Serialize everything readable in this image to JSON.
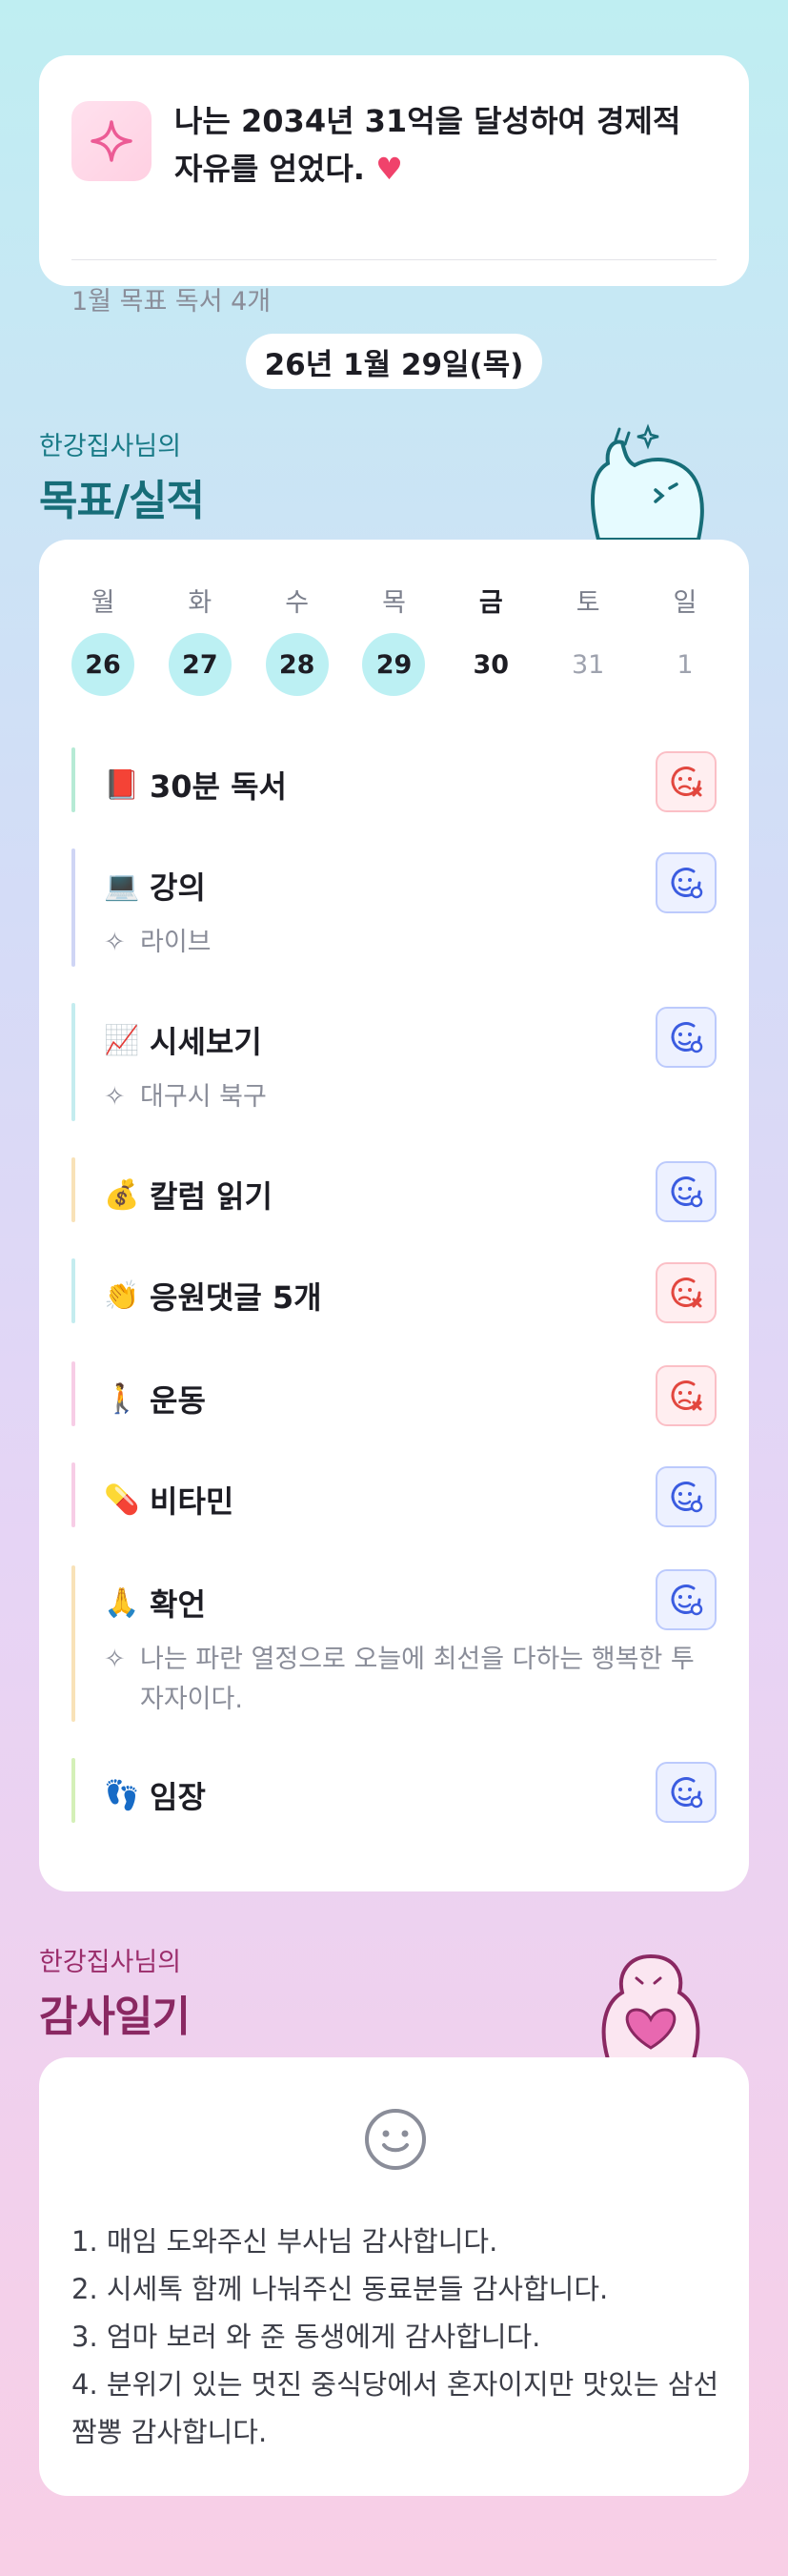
{
  "goal": {
    "text": "나는 2034년 31억을 달성하여 경제적 자유를 얻었다.",
    "heart": "♥",
    "sub": "1월 목표  독서 4개",
    "icon": "sparkle-icon"
  },
  "date": "26년 1월 29일(목)",
  "sections": {
    "tasks": {
      "owner": "한강집사님의",
      "title": "목표/실적"
    },
    "gratitude": {
      "owner": "한강집사님의",
      "title": "감사일기"
    }
  },
  "week": [
    {
      "day": "월",
      "num": "26",
      "state": "done"
    },
    {
      "day": "화",
      "num": "27",
      "state": "done"
    },
    {
      "day": "수",
      "num": "28",
      "state": "done"
    },
    {
      "day": "목",
      "num": "29",
      "state": "done"
    },
    {
      "day": "금",
      "num": "30",
      "state": "today"
    },
    {
      "day": "토",
      "num": "31",
      "state": "future"
    },
    {
      "day": "일",
      "num": "1",
      "state": "future"
    }
  ],
  "tasks": [
    {
      "emoji": "📕",
      "label": "30분 독서",
      "note": "",
      "status": "fail",
      "bar": "#b6ead5"
    },
    {
      "emoji": "💻",
      "label": "강의",
      "note": "라이브",
      "status": "ok",
      "bar": "#cfd5f5"
    },
    {
      "emoji": "📈",
      "label": "시세보기",
      "note": "대구시 북구",
      "status": "ok",
      "bar": "#c4ecef"
    },
    {
      "emoji": "💰",
      "label": "칼럼 읽기",
      "note": "",
      "status": "ok",
      "bar": "#f8e2b8"
    },
    {
      "emoji": "👏",
      "label": "응원댓글 5개",
      "note": "",
      "status": "fail",
      "bar": "#c4ecef"
    },
    {
      "emoji": "🚶",
      "label": "운동",
      "note": "",
      "status": "fail",
      "bar": "#f7cde6"
    },
    {
      "emoji": "💊",
      "label": "비타민",
      "note": "",
      "status": "ok",
      "bar": "#f7cde6"
    },
    {
      "emoji": "🙏",
      "label": "확언",
      "note": "나는 파란 열정으로 오늘에 최선을 다하는 행복한 투자자이다.",
      "status": "ok",
      "bar": "#f8e2b8"
    },
    {
      "emoji": "👣",
      "label": "임장",
      "note": "",
      "status": "ok",
      "bar": "#d4f0b8"
    }
  ],
  "gratitude": {
    "icon": "smile-icon",
    "items": [
      "1. 매임 도와주신 부사님 감사합니다.",
      "2. 시세톡 함께 나눠주신 동료분들 감사합니다.",
      "3. 엄마 보러 와 준 동생에게 감사합니다.",
      "4. 분위기 있는 멋진 중식당에서 혼자이지만 맛있는 삼선짬뽕 감사합니다."
    ]
  },
  "colors": {
    "ok": "#3b5ce0",
    "fail": "#e2473f",
    "teal": "#176d78",
    "plum": "#8a2862"
  }
}
